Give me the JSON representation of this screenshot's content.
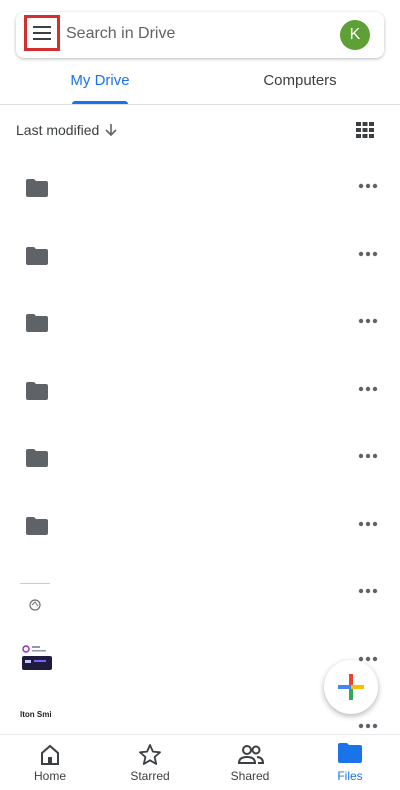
{
  "search": {
    "placeholder": "Search in Drive",
    "avatar_initial": "K",
    "avatar_color": "#5e9f36"
  },
  "tabs": [
    {
      "label": "My Drive",
      "active": true
    },
    {
      "label": "Computers",
      "active": false
    }
  ],
  "sort": {
    "label": "Last modified",
    "direction": "descending"
  },
  "files": [
    {
      "type": "folder",
      "icon": "folder-icon"
    },
    {
      "type": "folder",
      "icon": "folder-icon"
    },
    {
      "type": "folder",
      "icon": "folder-icon"
    },
    {
      "type": "folder",
      "icon": "folder-icon"
    },
    {
      "type": "folder",
      "icon": "folder-icon"
    },
    {
      "type": "folder",
      "icon": "folder-icon"
    },
    {
      "type": "image",
      "icon": "image-thumbnail"
    },
    {
      "type": "image",
      "icon": "image-thumbnail"
    },
    {
      "type": "image",
      "icon": "image-thumbnail",
      "thumb_text": "lton Smi"
    }
  ],
  "fab": {
    "icon": "plus-icon"
  },
  "bottom_nav": [
    {
      "label": "Home",
      "icon": "home-icon",
      "active": false
    },
    {
      "label": "Starred",
      "icon": "star-icon",
      "active": false
    },
    {
      "label": "Shared",
      "icon": "people-icon",
      "active": false
    },
    {
      "label": "Files",
      "icon": "folder-icon",
      "active": true
    }
  ],
  "colors": {
    "accent": "#1a73e8",
    "highlight_box": "#d32f2f",
    "folder": "#5f6368"
  }
}
